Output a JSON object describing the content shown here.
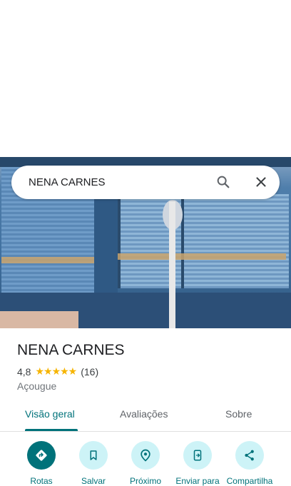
{
  "search": {
    "query": "NENA CARNES"
  },
  "place": {
    "name": "NENA CARNES",
    "rating": "4,8",
    "stars": "★★★★★",
    "reviews_count": "(16)",
    "category": "Açougue"
  },
  "tabs": [
    {
      "label": "Visão geral",
      "active": true
    },
    {
      "label": "Avaliações",
      "active": false
    },
    {
      "label": "Sobre",
      "active": false
    }
  ],
  "actions": [
    {
      "label": "Rotas",
      "icon": "directions-icon"
    },
    {
      "label": "Salvar",
      "icon": "bookmark-icon"
    },
    {
      "label": "Próximo",
      "icon": "nearby-icon"
    },
    {
      "label": "Enviar para",
      "icon": "send-to-phone-icon"
    },
    {
      "label": "Compartilha",
      "icon": "share-icon"
    }
  ],
  "colors": {
    "accent": "#00727a",
    "action_bg": "#cdf3f7",
    "star": "#f6b400"
  }
}
